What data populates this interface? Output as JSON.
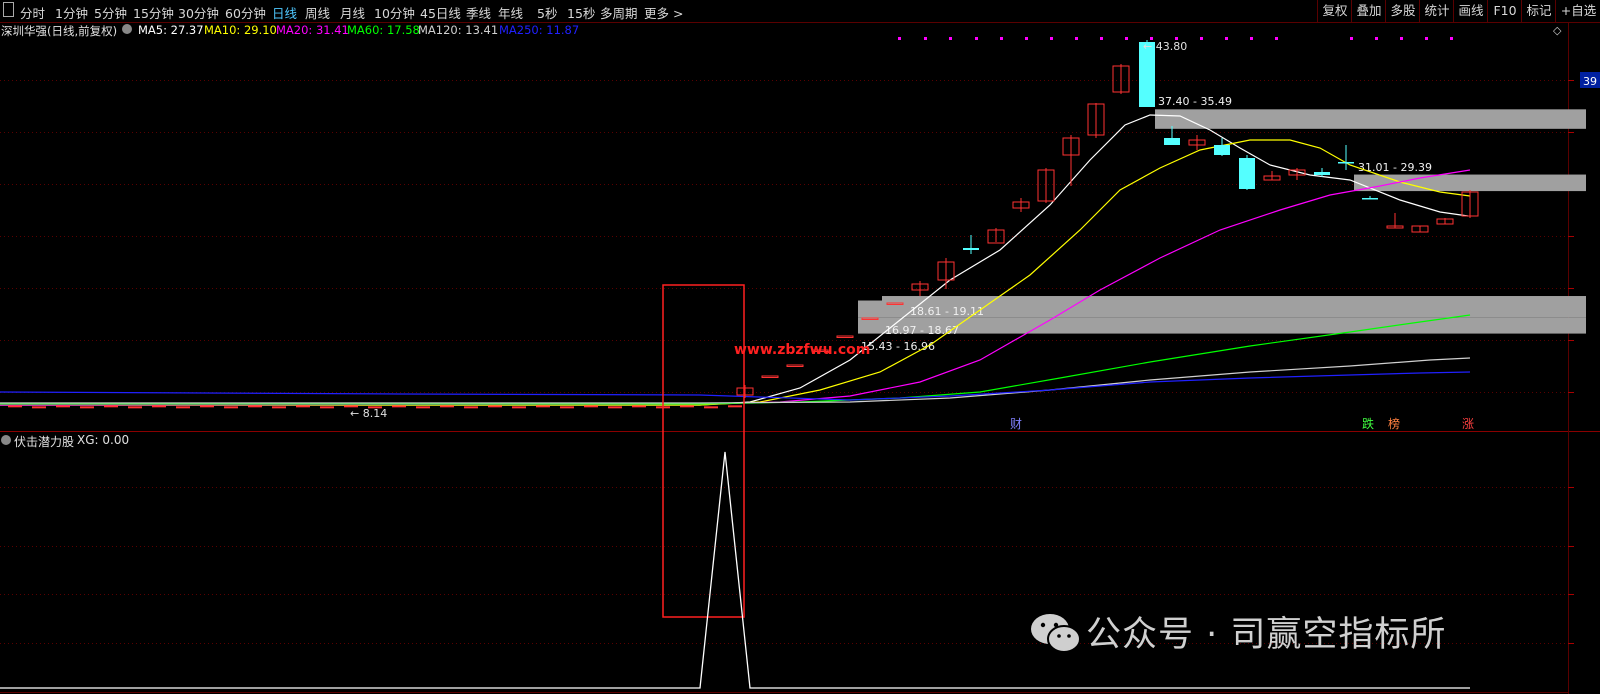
{
  "toolbar": {
    "left_icon": "panel-toggle-icon",
    "periods": [
      {
        "label": "分时",
        "active": false
      },
      {
        "label": "1分钟",
        "active": false
      },
      {
        "label": "5分钟",
        "active": false
      },
      {
        "label": "15分钟",
        "active": false
      },
      {
        "label": "30分钟",
        "active": false
      },
      {
        "label": "60分钟",
        "active": false
      },
      {
        "label": "日线",
        "active": true
      },
      {
        "label": "周线",
        "active": false
      },
      {
        "label": "月线",
        "active": false
      },
      {
        "label": "10分钟",
        "active": false
      },
      {
        "label": "45日线",
        "active": false
      },
      {
        "label": "季线",
        "active": false
      },
      {
        "label": "年线",
        "active": false
      },
      {
        "label": "5秒",
        "active": false
      },
      {
        "label": "15秒",
        "active": false
      },
      {
        "label": "多周期",
        "active": false
      },
      {
        "label": "更多 >",
        "active": false
      }
    ],
    "right_buttons": [
      "复权",
      "叠加",
      "多股",
      "统计",
      "画线",
      "F10",
      "标记",
      "+自选"
    ]
  },
  "legend": {
    "stock_name": "深圳华强(日线,前复权)",
    "ma_items": [
      {
        "label": "MA5: 27.37",
        "color": "#ffffff"
      },
      {
        "label": "MA10: 29.10",
        "color": "#ffff00"
      },
      {
        "label": "MA20: 31.41",
        "color": "#ff00ff"
      },
      {
        "label": "MA60: 17.58",
        "color": "#00ff00"
      },
      {
        "label": "MA120: 13.41",
        "color": "#d0d0d0"
      },
      {
        "label": "MA250: 11.87",
        "color": "#2020ff"
      }
    ],
    "right_price_tag": "39"
  },
  "annotations": {
    "high_label": "← 43.80",
    "low_label": "← 8.14",
    "zone_labels": [
      "37.40 - 35.49",
      "31.01 - 29.39",
      "18.61 - 19.11",
      "16.97 - 18.67",
      "15.43 - 16.96"
    ],
    "event_markers": [
      {
        "text": "财",
        "color": "#8080ff"
      },
      {
        "text": "跌",
        "color": "#40ff40"
      },
      {
        "text": "榜",
        "color": "#ff8040"
      },
      {
        "text": "涨",
        "color": "#ff4040"
      }
    ],
    "site_watermark": "www.zbzfwu.com"
  },
  "sub_indicator": {
    "name": "伏击潜力股",
    "value_label": "XG: 0.00"
  },
  "watermark": {
    "icon": "wechat-icon",
    "text": "公众号 · 司赢空指标所"
  },
  "chart_data": {
    "type": "candlestick",
    "title": "深圳华强(日线,前复权)",
    "price_range": [
      8.14,
      43.8
    ],
    "highlighted_region": "signal spike in indicator panel",
    "ma_values": {
      "MA5": 27.37,
      "MA10": 29.1,
      "MA20": 31.41,
      "MA60": 17.58,
      "MA120": 13.41,
      "MA250": 11.87
    },
    "resistance_zones": [
      [
        35.49,
        37.4
      ],
      [
        29.39,
        31.01
      ],
      [
        18.61,
        19.11
      ],
      [
        16.97,
        18.67
      ],
      [
        15.43,
        16.96
      ]
    ],
    "indicator": {
      "name": "伏击潜力股",
      "XG": 0.0,
      "signal_peaks": 1
    },
    "colors": {
      "up": "#ff3232",
      "down": "#54ffff",
      "grid": "#5a0000",
      "zone": "#a0a0a0"
    }
  }
}
